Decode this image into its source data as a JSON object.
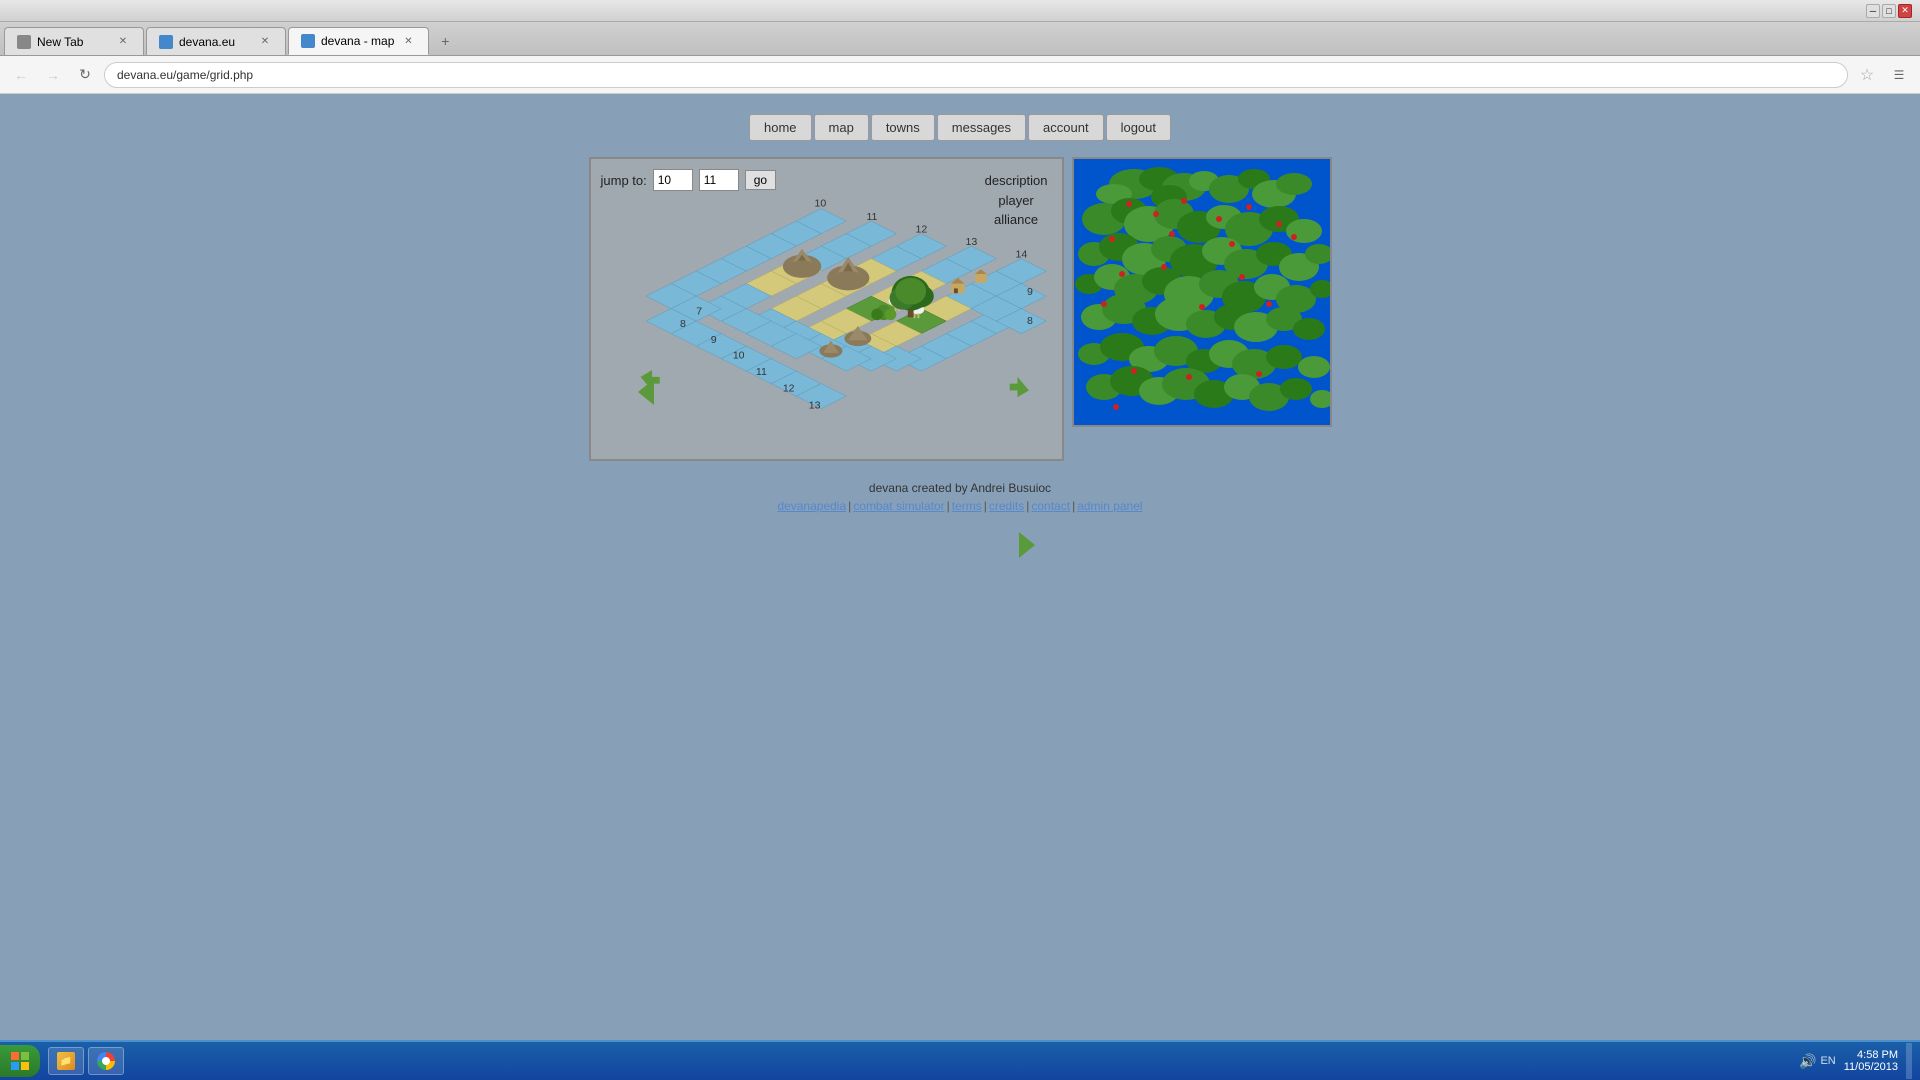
{
  "browser": {
    "title": "devana - map",
    "tabs": [
      {
        "label": "New Tab",
        "active": false,
        "icon": "tab-icon"
      },
      {
        "label": "devana.eu",
        "active": false,
        "icon": "tab-icon"
      },
      {
        "label": "devana - map",
        "active": true,
        "icon": "tab-icon"
      }
    ],
    "url": "devana.eu/game/grid.php",
    "new_tab_label": "+"
  },
  "nav": {
    "items": [
      "home",
      "map",
      "towns",
      "messages",
      "account",
      "logout"
    ]
  },
  "map_panel": {
    "jump_label": "jump to:",
    "coord_x": "10",
    "coord_y": "11",
    "go_label": "go",
    "info_description": "description",
    "info_player": "player",
    "info_alliance": "alliance",
    "col_labels": [
      "14",
      "13",
      "12",
      "11",
      "10",
      "9",
      "8",
      "8",
      "9",
      "10",
      "11",
      "12",
      "13"
    ],
    "row_labels": [
      "7",
      "8",
      "9",
      "10"
    ]
  },
  "footer": {
    "created_by": "devana created by Andrei Busuioc",
    "links": [
      "devanapedia",
      "combat simulator",
      "terms",
      "credits",
      "contact",
      "admin panel"
    ],
    "separators": [
      "|",
      "|",
      "|",
      "|",
      "|"
    ]
  },
  "taskbar": {
    "start_label": "Start",
    "time": "4:58 PM",
    "date": "11/05/2013",
    "lang": "EN",
    "apps": [
      {
        "name": "Windows Explorer"
      },
      {
        "name": "Google Chrome"
      }
    ]
  }
}
